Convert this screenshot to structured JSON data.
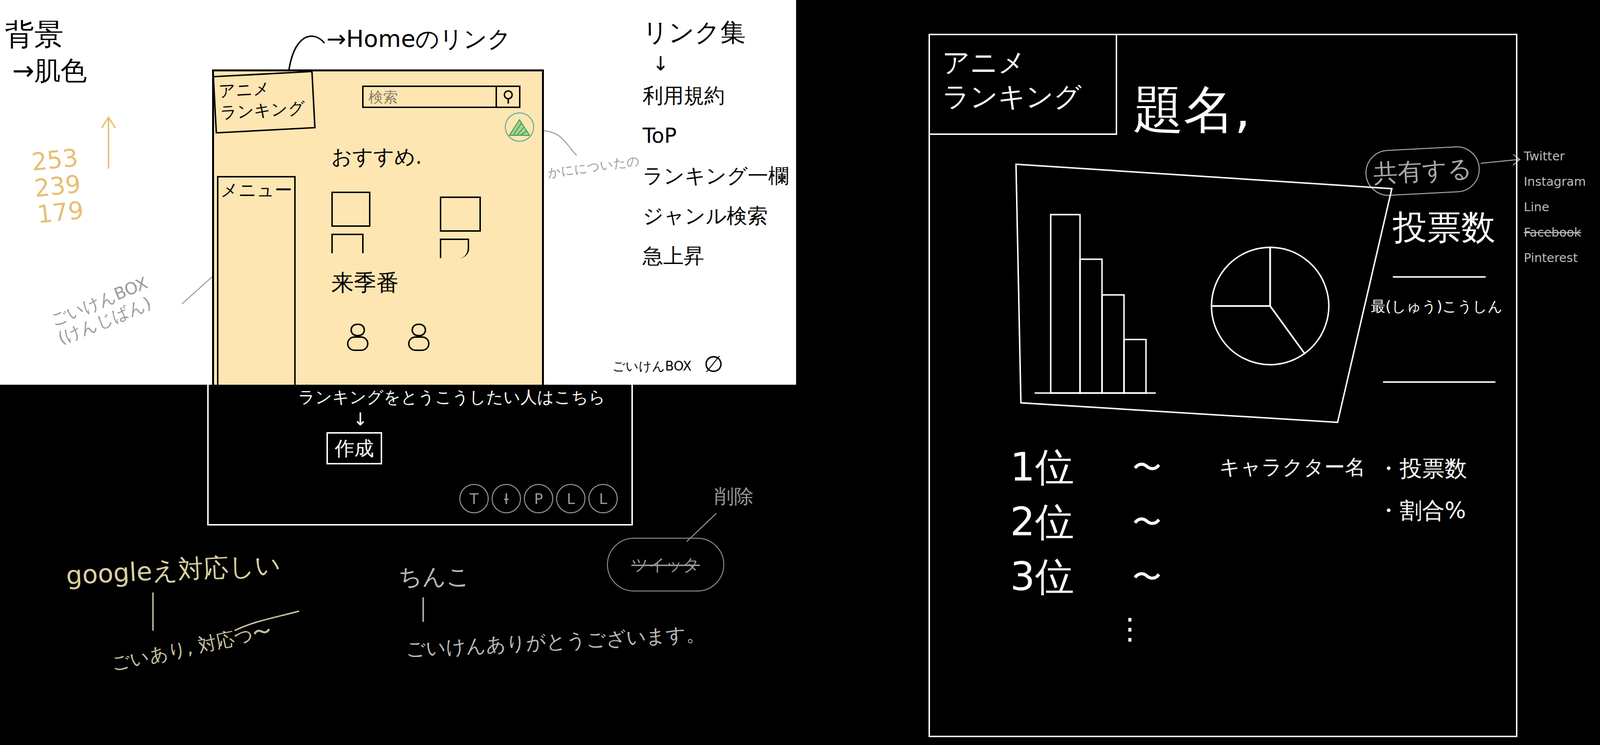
{
  "wireframe_home": {
    "notes": {
      "background": "背景",
      "background_color": "→肌色",
      "rgb": [
        "253",
        "239",
        "179"
      ],
      "home_link": "→Homeのリンク",
      "login": "かにについたの",
      "feedback": "ごいけんBOX\n(けんじばん)"
    },
    "logo": "アニメ\nランキング",
    "search": {
      "placeholder": "検索"
    },
    "recommended": "おすすめ.",
    "upcoming": "来季番",
    "menu": "メニュー",
    "links": {
      "title": "リンク集",
      "arrow": "↓",
      "items": [
        "利用規約",
        "ToP",
        "ランキング一欄",
        "ジャンル検索",
        "急上昇"
      ]
    },
    "feedback_box": "ごいけんBOX",
    "feedback_mark": "∅",
    "post": {
      "prompt": "ランキングをとうこうしたい人はこちら",
      "arrow": "↓",
      "button": "作成"
    },
    "social": [
      {
        "label": "T",
        "crossed": false
      },
      {
        "label": "I",
        "crossed": true
      },
      {
        "label": "P",
        "crossed": false
      },
      {
        "label": "L",
        "crossed": false
      },
      {
        "label": "L",
        "crossed": false
      }
    ],
    "removed": {
      "note": "削除",
      "label": "ツイッタ",
      "crossed": true
    }
  },
  "comments": [
    {
      "text": "googleえ対応しい"
    },
    {
      "text": "ごいあり, 対応つ〜"
    },
    {
      "text": "ちんこ"
    },
    {
      "text": "ごいけんありがとうございます。"
    }
  ],
  "wireframe_ranking": {
    "logo": "アニメ\nランキング",
    "title": "題名,",
    "share": {
      "label": "共有する",
      "targets": [
        {
          "label": "Twitter",
          "crossed": false
        },
        {
          "label": "Instagram",
          "crossed": false
        },
        {
          "label": "Line",
          "crossed": false
        },
        {
          "label": "Facebook",
          "crossed": true
        },
        {
          "label": "Pinterest",
          "crossed": false
        }
      ]
    },
    "chart": {
      "bars": [
        100,
        75,
        55,
        30
      ],
      "pie": [
        40,
        35,
        25
      ]
    },
    "votes": "投票数",
    "updated": "最(しゅう)こうしん",
    "ranks": [
      {
        "rank": "1位",
        "tilde": "〜",
        "name": "キャラクター名"
      },
      {
        "rank": "2位",
        "tilde": "〜"
      },
      {
        "rank": "3位",
        "tilde": "〜"
      }
    ],
    "more": "⋮",
    "columns": [
      "・投票数",
      "・割合%"
    ]
  }
}
